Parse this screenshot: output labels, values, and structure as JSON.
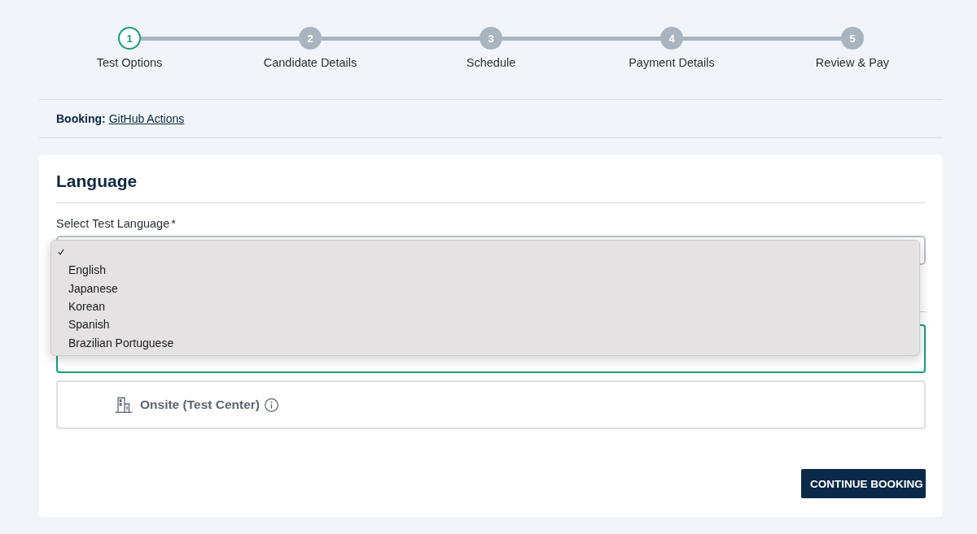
{
  "stepper": [
    {
      "number": "1",
      "label": "Test Options",
      "selected": true
    },
    {
      "number": "2",
      "label": "Candidate Details",
      "selected": false
    },
    {
      "number": "3",
      "label": "Schedule",
      "selected": false
    },
    {
      "number": "4",
      "label": "Payment Details",
      "selected": false
    },
    {
      "number": "5",
      "label": "Review & Pay",
      "selected": false
    }
  ],
  "booking": {
    "label": "Booking:",
    "link": "GitHub Actions"
  },
  "section": {
    "title": "Language"
  },
  "language_select": {
    "label": "Select Test Language",
    "required_mark": "*",
    "expanded": true,
    "options": [
      {
        "selected": true
      },
      {
        "label": "English",
        "selected": false
      },
      {
        "label": "Japanese",
        "selected": false
      },
      {
        "label": "Korean",
        "selected": false
      },
      {
        "label": "Spanish",
        "selected": false
      },
      {
        "label": "Brazilian Portuguese",
        "selected": false
      }
    ]
  },
  "delivery_options": [
    {
      "selected": true
    },
    {
      "kind": "onsite",
      "label": "Onsite (Test Center)",
      "selected": false
    }
  ],
  "buttons": [
    {
      "label": "CONTINUE BOOKING"
    }
  ]
}
